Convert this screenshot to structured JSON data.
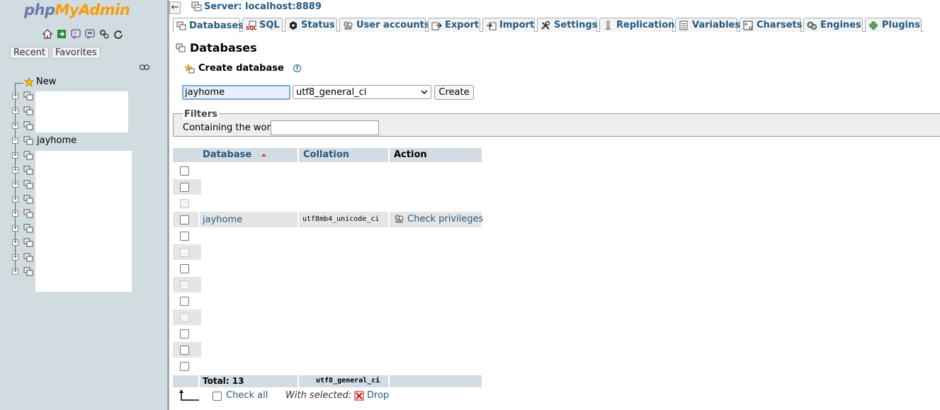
{
  "sidebar": {
    "logo_php": "php",
    "logo_rest": "MyAdmin",
    "icons": [
      "home-icon",
      "exit-icon",
      "docs-icon",
      "help-icon",
      "settings-icon",
      "reload-icon"
    ],
    "tabs": [
      {
        "label": "Recent"
      },
      {
        "label": "Favorites"
      }
    ],
    "tree_new": "New",
    "tree_db": "jayhome"
  },
  "breadcrumb": {
    "back": "←",
    "server_label": "Server: localhost:8889"
  },
  "tabs": [
    {
      "label": "Databases",
      "icon": "database-icon"
    },
    {
      "label": "SQL",
      "icon": "sql-icon"
    },
    {
      "label": "Status",
      "icon": "status-icon"
    },
    {
      "label": "User accounts",
      "icon": "users-icon"
    },
    {
      "label": "Export",
      "icon": "export-icon"
    },
    {
      "label": "Import",
      "icon": "import-icon"
    },
    {
      "label": "Settings",
      "icon": "settings-icon"
    },
    {
      "label": "Replication",
      "icon": "replication-icon"
    },
    {
      "label": "Variables",
      "icon": "variables-icon"
    },
    {
      "label": "Charsets",
      "icon": "charsets-icon"
    },
    {
      "label": "Engines",
      "icon": "engines-icon"
    },
    {
      "label": "Plugins",
      "icon": "plugins-icon"
    }
  ],
  "main": {
    "title": "Databases",
    "create_heading": "Create database",
    "help": "?",
    "db_name_value": "jayhome",
    "collation_value": "utf8_general_ci",
    "create_button": "Create",
    "filters_legend": "Filters",
    "filter_label": "Containing the word:",
    "filter_value": ""
  },
  "table": {
    "headers": {
      "database": "Database",
      "collation": "Collation",
      "action": "Action"
    },
    "visible_row": {
      "name": "jayhome",
      "collation": "utf8mb4_unicode_ci",
      "action": "Check privileges"
    },
    "total_label": "Total: 13",
    "total_collation": "utf8_general_ci",
    "check_all": "Check all",
    "with_selected": "With selected:",
    "drop": "Drop"
  },
  "colors": {
    "link": "#235a81",
    "header_bg": "#d3dce3",
    "sidebar_bg": "#d0dce0"
  }
}
